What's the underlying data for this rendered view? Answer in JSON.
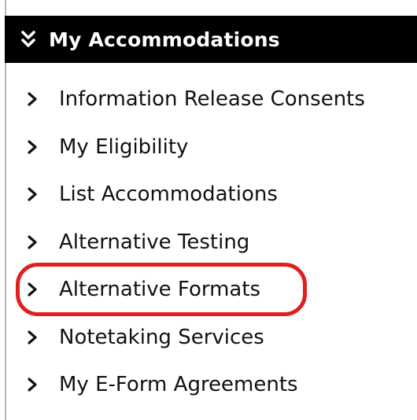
{
  "header": {
    "title": "My Accommodations",
    "icon": "double-chevron-down-icon"
  },
  "menu": {
    "items": [
      {
        "label": "Information Release Consents",
        "icon": "chevron-right-icon"
      },
      {
        "label": "My Eligibility",
        "icon": "chevron-right-icon"
      },
      {
        "label": "List Accommodations",
        "icon": "chevron-right-icon"
      },
      {
        "label": "Alternative Testing",
        "icon": "chevron-right-icon"
      },
      {
        "label": "Alternative Formats",
        "icon": "chevron-right-icon",
        "highlighted": true
      },
      {
        "label": "Notetaking Services",
        "icon": "chevron-right-icon"
      },
      {
        "label": "My E-Form Agreements",
        "icon": "chevron-right-icon"
      }
    ]
  },
  "colors": {
    "header_bg": "#000000",
    "header_text": "#ffffff",
    "highlight_ring": "#e0201f",
    "panel_border": "#b9b9b9"
  }
}
